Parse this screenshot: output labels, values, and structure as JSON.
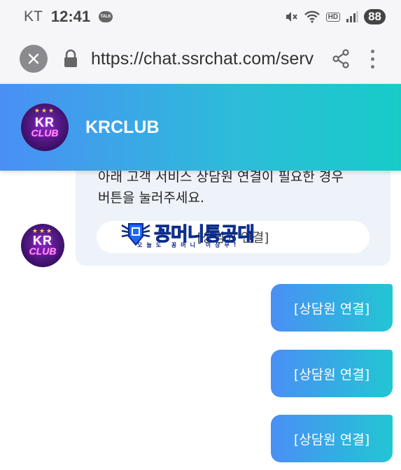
{
  "status": {
    "carrier": "KT",
    "time": "12:41",
    "talk_badge": "TALK",
    "hd": "HD",
    "battery": "88"
  },
  "browser": {
    "url": "https://chat.ssrchat.com/serv"
  },
  "header": {
    "logo_top": "KR",
    "logo_bottom": "CLUB",
    "title": "KRCLUB"
  },
  "chat": {
    "bot_message_line1": "아래 고객 서비스 상담원 연결이 필요한 경우",
    "bot_message_line2": "버튼을 눌러주세요.",
    "bot_button_label": "[상담원 연결]",
    "user_messages": [
      "[상담원 연결]",
      "[상담원 연결]",
      "[상담원 연결]"
    ]
  },
  "watermark": {
    "title": "꽁머니통공대",
    "subtitle": "오늘도 꽁머니 이상무!"
  },
  "colors": {
    "header_gradient_start": "#4a8ff5",
    "header_gradient_end": "#17ccc8",
    "bot_bubble": "#eef3fa"
  }
}
